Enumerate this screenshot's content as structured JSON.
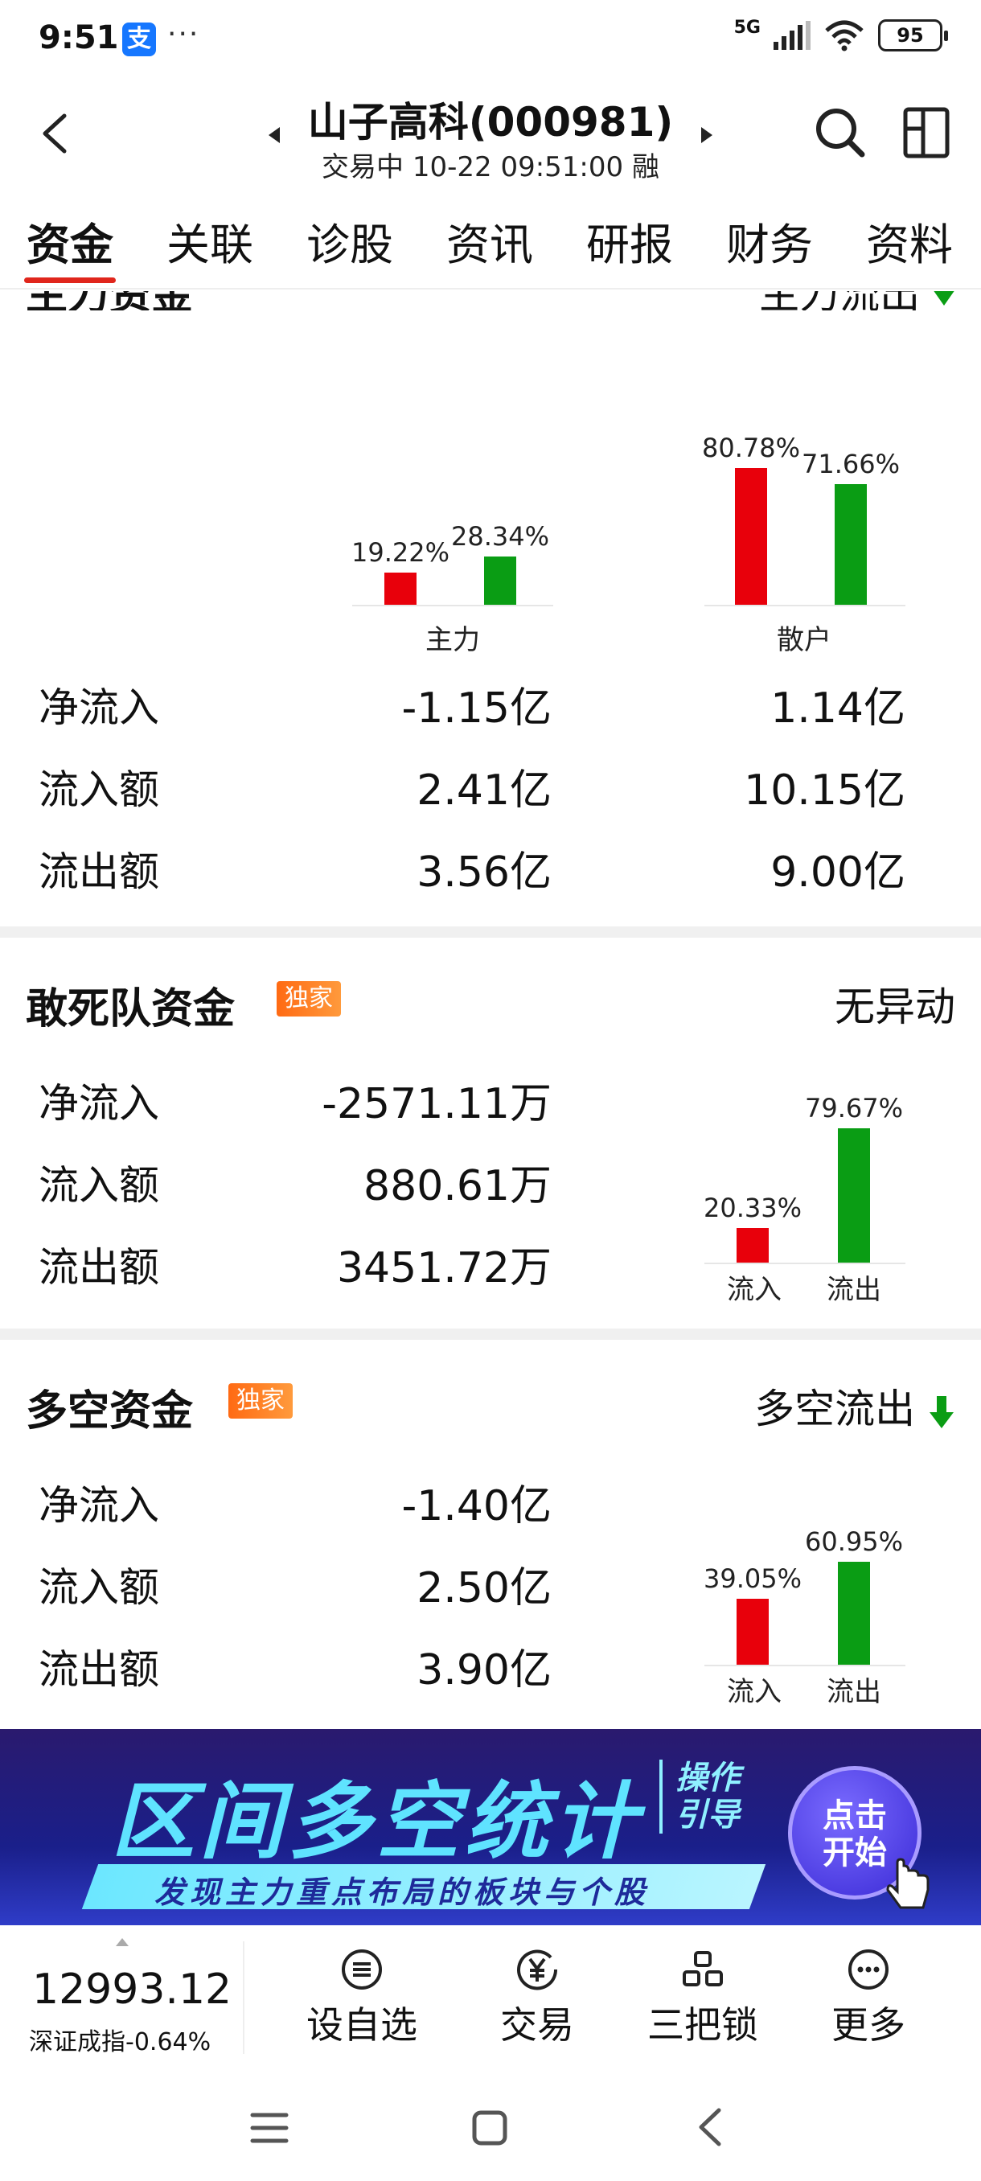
{
  "status_bar": {
    "time": "9:51",
    "alipay": "支",
    "dots": "···",
    "network": "5G",
    "battery": "95"
  },
  "header": {
    "title": "山子高科(000981)",
    "subtitle": "交易中 10-22 09:51:00 融"
  },
  "tabs": [
    "资金",
    "关联",
    "诊股",
    "资讯",
    "研报",
    "财务",
    "资料"
  ],
  "main_fund": {
    "title": "主力资金",
    "right_label": "主力流出",
    "chart": {
      "groups": [
        {
          "label": "主力",
          "red_pct": "19.22%",
          "green_pct": "28.34%",
          "red": 19.22,
          "green": 28.34
        },
        {
          "label": "散户",
          "red_pct": "80.78%",
          "green_pct": "71.66%",
          "red": 80.78,
          "green": 71.66
        }
      ]
    },
    "rows": [
      {
        "label": "净流入",
        "main": "-1.15亿",
        "retail": "1.14亿"
      },
      {
        "label": "流入额",
        "main": "2.41亿",
        "retail": "10.15亿"
      },
      {
        "label": "流出额",
        "main": "3.56亿",
        "retail": "9.00亿"
      }
    ]
  },
  "dare_fund": {
    "title": "敢死队资金",
    "badge": "独家",
    "right_label": "无异动",
    "rows": [
      {
        "label": "净流入",
        "value": "-2571.11万"
      },
      {
        "label": "流入额",
        "value": "880.61万"
      },
      {
        "label": "流出额",
        "value": "3451.72万"
      }
    ],
    "chart": {
      "in_pct": "20.33%",
      "out_pct": "79.67%",
      "in": 20.33,
      "out": 79.67,
      "in_label": "流入",
      "out_label": "流出"
    }
  },
  "longshort_fund": {
    "title": "多空资金",
    "badge": "独家",
    "right_label": "多空流出",
    "rows": [
      {
        "label": "净流入",
        "value": "-1.40亿"
      },
      {
        "label": "流入额",
        "value": "2.50亿"
      },
      {
        "label": "流出额",
        "value": "3.90亿"
      }
    ],
    "chart": {
      "in_pct": "39.05%",
      "out_pct": "60.95%",
      "in": 39.05,
      "out": 60.95,
      "in_label": "流入",
      "out_label": "流出"
    }
  },
  "banner": {
    "title": "区间多空统计",
    "side_text_1": "操作",
    "side_text_2": "引导",
    "subtitle": "发现主力重点布局的板块与个股",
    "button_line1": "点击",
    "button_line2": "开始"
  },
  "toolbar": {
    "index_value": "12993.12",
    "index_sub": "深证成指-0.64%",
    "tools": [
      {
        "label": "设自选",
        "icon": "list-circle-icon"
      },
      {
        "label": "交易",
        "icon": "yuan-circle-icon"
      },
      {
        "label": "三把锁",
        "icon": "lock-icon"
      },
      {
        "label": "更多",
        "icon": "more-icon"
      }
    ]
  },
  "colors": {
    "red": "#e8000b",
    "green": "#0a9d14",
    "accent": "#e0261c"
  }
}
